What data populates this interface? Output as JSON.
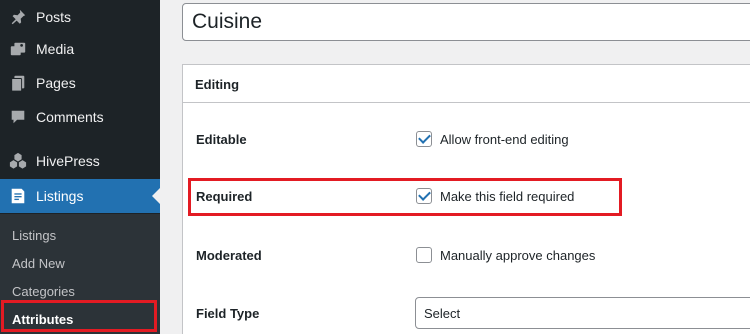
{
  "sidebar": {
    "items": [
      {
        "label": "Posts",
        "icon": "pin-icon"
      },
      {
        "label": "Media",
        "icon": "media-icon"
      },
      {
        "label": "Pages",
        "icon": "pages-icon"
      },
      {
        "label": "Comments",
        "icon": "comments-icon"
      },
      {
        "label": "HivePress",
        "icon": "hivepress-icon"
      },
      {
        "label": "Listings",
        "icon": "listings-icon",
        "active": true
      }
    ],
    "submenu": [
      {
        "label": "Listings"
      },
      {
        "label": "Add New"
      },
      {
        "label": "Categories"
      },
      {
        "label": "Attributes",
        "current": true
      }
    ]
  },
  "title": {
    "value": "Cuisine"
  },
  "panel": {
    "heading": "Editing",
    "rows": [
      {
        "label": "Editable",
        "control_label": "Allow front-end editing",
        "checked": true
      },
      {
        "label": "Required",
        "control_label": "Make this field required",
        "checked": true
      },
      {
        "label": "Moderated",
        "control_label": "Manually approve changes",
        "checked": false
      },
      {
        "label": "Field Type",
        "control_label": "Select"
      }
    ]
  },
  "colors": {
    "sidebar_bg": "#1d2327",
    "submenu_bg": "#2c3338",
    "active": "#2271b1",
    "highlight": "#e31b23"
  }
}
